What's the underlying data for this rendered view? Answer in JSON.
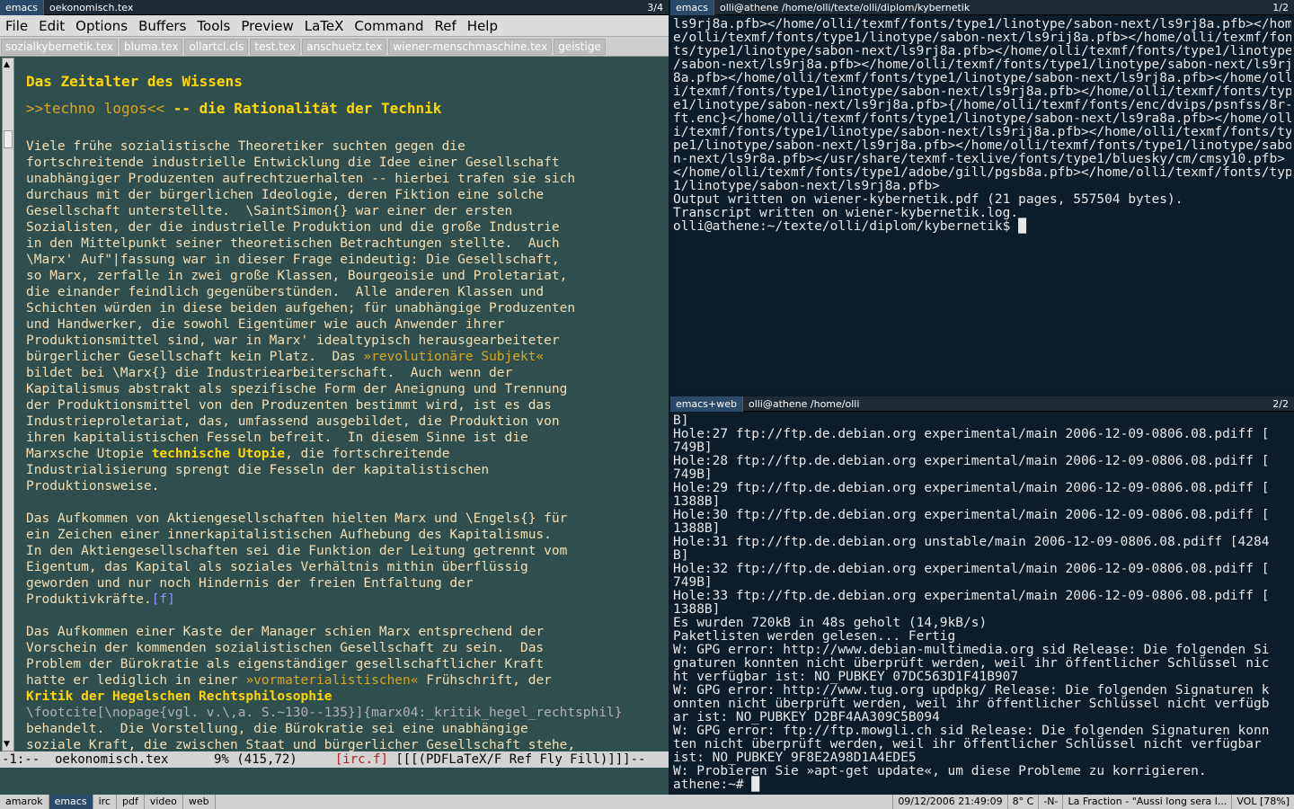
{
  "left": {
    "tabs": [
      "emacs",
      "oekonomisch.tex"
    ],
    "win_num": "3/4",
    "menu": [
      "File",
      "Edit",
      "Options",
      "Buffers",
      "Tools",
      "Preview",
      "LaTeX",
      "Command",
      "Ref",
      "Help"
    ],
    "buffer_tabs": [
      "sozialkybernetik.tex",
      "bluma.tex",
      "ollartcl.cls",
      "test.tex",
      "anschuetz.tex",
      "wiener-menschmaschine.tex",
      "geistige"
    ],
    "title": "Das Zeitalter des Wissens",
    "subtitle_pre": ">>techno logos<<",
    "subtitle_post": " -- die Rationalität der Technik",
    "para1": "Viele frühe sozialistische Theoretiker suchten gegen die\nfortschreitende industrielle Entwicklung die Idee einer Gesellschaft\nunabhängiger Produzenten aufrechtzuerhalten -- hierbei trafen sie sich\ndurchaus mit der bürgerlichen Ideologie, deren Fiktion eine solche\nGesellschaft unterstellte.  \\SaintSimon{} war einer der ersten\nSozialisten, der die industrielle Produktion und die große Industrie\nin den Mittelpunkt seiner theoretischen Betrachtungen stellte.  Auch\n\\Marx' Auf\"|fassung war in dieser Frage eindeutig: Die Gesellschaft,\nso Marx, zerfalle in zwei große Klassen, Bourgeoisie und Proletariat,\ndie einander feindlich gegenüberstünden.  Alle anderen Klassen und\nSchichten würden in diese beiden aufgehen; für unabhängige Produzenten\nund Handwerker, die sowohl Eigentümer wie auch Anwender ihrer\nProduktionsmittel sind, war in Marx' idealtypisch herausgearbeiteter\nbürgerlicher Gesellschaft kein Platz.  Das ",
    "quote1": "»revolutionäre Subjekt«",
    "para1b": "\nbildet bei \\Marx{} die Industriearbeiterschaft.  Auch wenn der\nKapitalismus abstrakt als spezifische Form der Aneignung und Trennung\nder Produktionsmittel von den Produzenten bestimmt wird, ist es das\nIndustrieproletariat, das, umfassend ausgebildet, die Produktion von\nihren kapitalistischen Fesseln befreit.  In diesem Sinne ist die\nMarxsche Utopie ",
    "kw1": "technische Utopie",
    "para1c": ", die fortschreitende\nIndustrialisierung sprengt die Fesseln der kapitalistischen\nProduktionsweise.",
    "para2": "Das Aufkommen von Aktiengesellschaften hielten Marx und \\Engels{} für\nein Zeichen einer innerkapitalistischen Aufhebung des Kapitalismus.\nIn den Aktiengesellschaften sei die Funktion der Leitung getrennt vom\nEigentum, das Kapital als soziales Verhältnis mithin überflüssig\ngeworden und nur noch Hindernis der freien Entfaltung der\nProduktivkräfte.",
    "fn": "[f]",
    "para3": "Das Aufkommen einer Kaste der Manager schien Marx entsprechend der\nVorschein der kommenden sozialistischen Gesellschaft zu sein.  Das\nProblem der Bürokratie als eigenständiger gesellschaftlicher Kraft\nhatte er lediglich in einer ",
    "quote2": "»vormaterialistischen«",
    "para3b": " Frühschrift, der\n",
    "kw2": "Kritik der Hegelschen Rechtsphilosophie",
    "footcite": "\\footcite[\\nopage{vgl. v.\\,a. S.~130--135}]{marx04:_kritik_hegel_rechtsphil}",
    "para3c": "\nbehandelt.  Die Vorstellung, die Bürokratie sei eine unabhängige\nsoziale Kraft, die zwischen Staat und bürgerlicher Gesellschaft stehe,",
    "modeline_a": "-1:--  oekonomisch.tex      9% (415,72)     ",
    "modeline_irc": "[irc.f]",
    "modeline_b": " [[[(PDFLaTeX/F Ref Fly Fill)]]]--"
  },
  "term1": {
    "tabs": [
      "emacs",
      "olli@athene /home/olli/texte/olli/diplom/kybernetik"
    ],
    "win_num": "1/2",
    "text": "ls9rj8a.pfb></home/olli/texmf/fonts/type1/linotype/sabon-next/ls9rj8a.pfb></hom\ne/olli/texmf/fonts/type1/linotype/sabon-next/ls9rij8a.pfb></home/olli/texmf/fon\nts/type1/linotype/sabon-next/ls9rj8a.pfb></home/olli/texmf/fonts/type1/linotype\n/sabon-next/ls9rj8a.pfb></home/olli/texmf/fonts/type1/linotype/sabon-next/ls9rj\n8a.pfb></home/olli/texmf/fonts/type1/linotype/sabon-next/ls9rj8a.pfb></home/oll\ni/texmf/fonts/type1/linotype/sabon-next/ls9rj8a.pfb></home/olli/texmf/fonts/typ\ne1/linotype/sabon-next/ls9rj8a.pfb>{/home/olli/texmf/fonts/enc/dvips/psnfss/8r-\nft.enc}</home/olli/texmf/fonts/type1/linotype/sabon-next/ls9ra8a.pfb></home/oll\ni/texmf/fonts/type1/linotype/sabon-next/ls9rij8a.pfb></home/olli/texmf/fonts/ty\npe1/linotype/sabon-next/ls9rj8a.pfb></home/olli/texmf/fonts/type1/linotype/sabo\nn-next/ls9r8a.pfb></usr/share/texmf-texlive/fonts/type1/bluesky/cm/cmsy10.pfb>\n</home/olli/texmf/fonts/type1/adobe/gill/pgsb8a.pfb></home/olli/texmf/fonts/type\n1/linotype/sabon-next/ls9rj8a.pfb>\nOutput written on wiener-kybernetik.pdf (21 pages, 557504 bytes).\nTranscript written on wiener-kybernetik.log.\nolli@athene:~/texte/olli/diplom/kybernetik$ █"
  },
  "term2": {
    "tabs": [
      "emacs+web",
      "olli@athene /home/olli"
    ],
    "win_num": "2/2",
    "text": "B]\nHole:27 ftp://ftp.de.debian.org experimental/main 2006-12-09-0806.08.pdiff [\n749B]\nHole:28 ftp://ftp.de.debian.org experimental/main 2006-12-09-0806.08.pdiff [\n749B]\nHole:29 ftp://ftp.de.debian.org experimental/main 2006-12-09-0806.08.pdiff [\n1388B]\nHole:30 ftp://ftp.de.debian.org experimental/main 2006-12-09-0806.08.pdiff [\n1388B]\nHole:31 ftp://ftp.de.debian.org unstable/main 2006-12-09-0806.08.pdiff [4284\nB]\nHole:32 ftp://ftp.de.debian.org experimental/main 2006-12-09-0806.08.pdiff [\n749B]\nHole:33 ftp://ftp.de.debian.org experimental/main 2006-12-09-0806.08.pdiff [\n1388B]\nEs wurden 720kB in 48s geholt (14,9kB/s)\nPaketlisten werden gelesen... Fertig\nW: GPG error: http://www.debian-multimedia.org sid Release: Die folgenden Si\ngnaturen konnten nicht überprüft werden, weil ihr öffentlicher Schlüssel nic\nht verfügbar ist: NO_PUBKEY 07DC563D1F41B907\nW: GPG error: http://www.tug.org updpkg/ Release: Die folgenden Signaturen k\nonnten nicht überprüft werden, weil ihr öffentlicher Schlüssel nicht verfügb\nar ist: NO_PUBKEY D2BF4AA309C5B094\nW: GPG error: ftp://ftp.mowgli.ch sid Release: Die folgenden Signaturen konn\nten nicht überprüft werden, weil ihr öffentlicher Schlüssel nicht verfügbar\nist: NO_PUBKEY 9F8E2A98D1A4EDE5\nW: Probieren Sie »apt-get update«, um diese Probleme zu korrigieren.\nathene:~# █"
  },
  "bottom": {
    "tags": [
      "amarok",
      "emacs",
      "irc",
      "pdf",
      "video",
      "web"
    ],
    "selected": "emacs",
    "clock": "09/12/2006 21:49:09",
    "temp": "8° C",
    "mode": "-N-",
    "song": "La Fraction - \"Aussi long sera l...",
    "vol": "VOL [78%]"
  }
}
